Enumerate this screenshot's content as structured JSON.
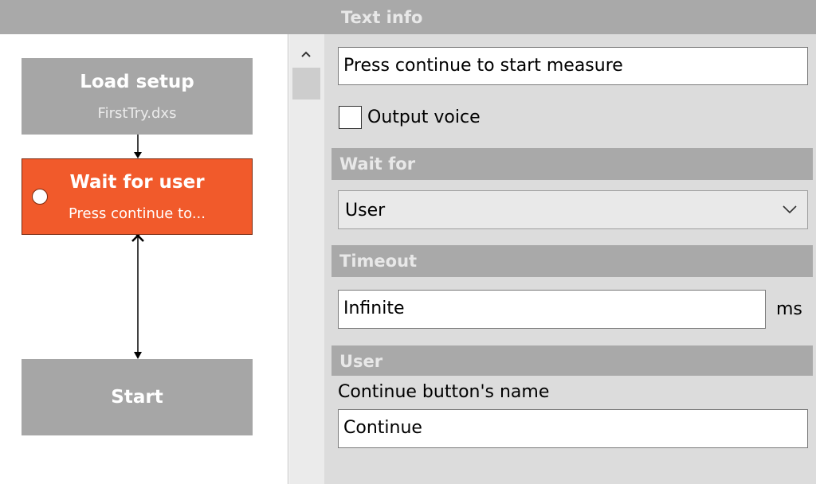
{
  "text_info": {
    "title": "Text info",
    "value": "Press continue to start measure",
    "output_voice_label": "Output voice",
    "output_voice_checked": false
  },
  "wait_for": {
    "title": "Wait for",
    "selected": "User"
  },
  "timeout": {
    "title": "Timeout",
    "value": "Infinite",
    "unit": "ms"
  },
  "user": {
    "title": "User",
    "button_name_label": "Continue button's name",
    "button_name_value": "Continue"
  },
  "flow": {
    "nodes": [
      {
        "title": "Load setup",
        "subtitle": "FirstTry.dxs"
      },
      {
        "title": "Wait for user",
        "subtitle": "Press continue to..."
      },
      {
        "title": "Start",
        "subtitle": ""
      }
    ]
  },
  "colors": {
    "selected_node": "#f15a2b",
    "node": "#a6a6a6",
    "section_bar": "#a9a9a9",
    "panel": "#dcdcdc"
  },
  "icons": {
    "scroll_up": "chevron-up-icon",
    "select_arrow": "chevron-down-icon",
    "connector_cross": "cross-icon"
  }
}
